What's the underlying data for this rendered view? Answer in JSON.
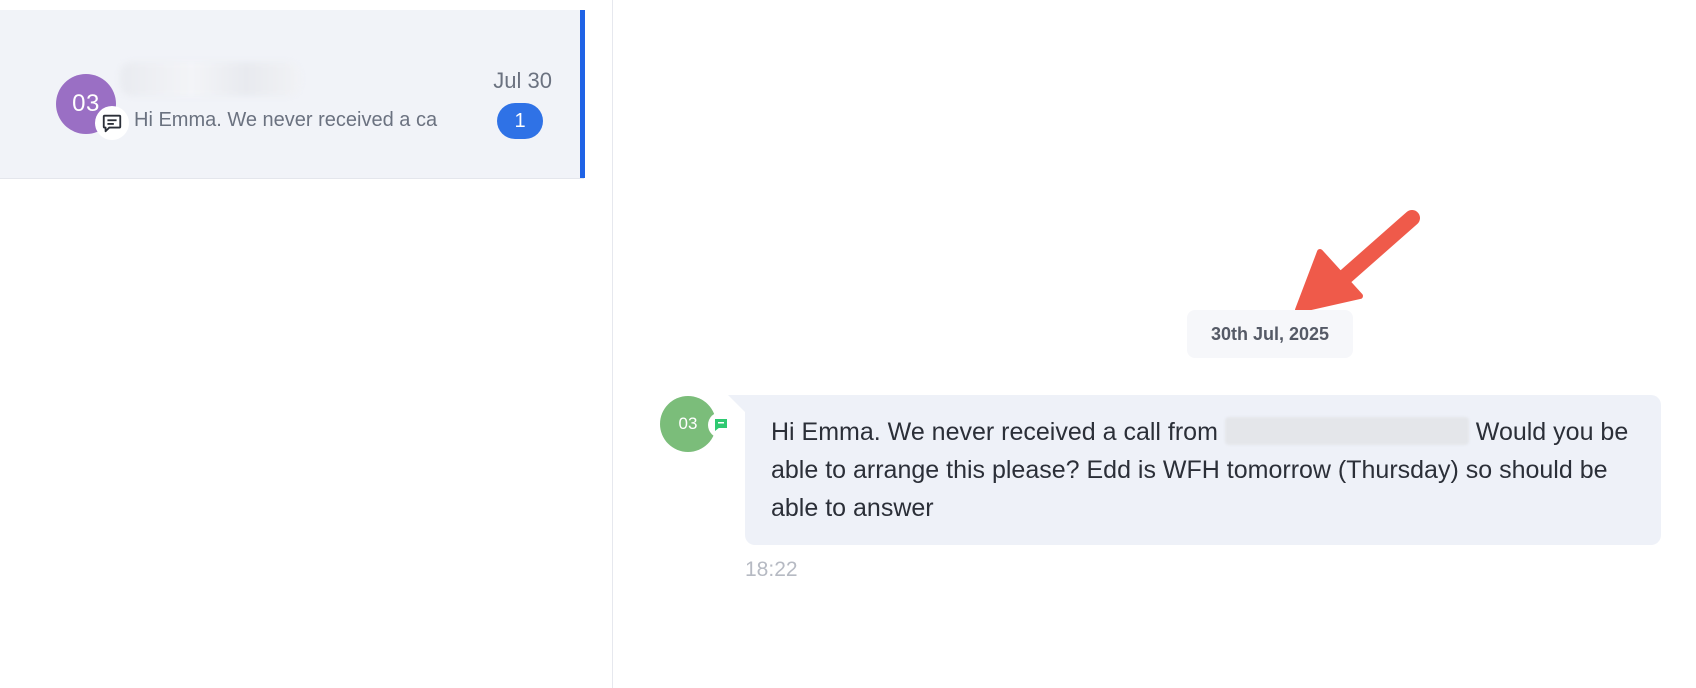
{
  "conversation_list": {
    "items": [
      {
        "avatar_initials": "03",
        "preview": "Hi Emma. We never received a ca",
        "date": "Jul 30",
        "unread_count": "1",
        "channel_icon": "chat-bubble-icon"
      }
    ]
  },
  "thread": {
    "date_separator": "30th Jul, 2025",
    "messages": [
      {
        "avatar_initials": "03",
        "channel_icon": "sms-icon",
        "text_part1": "Hi Emma. We never received a call from ",
        "text_part2": " Would you be able to arrange this please? Edd is WFH tomorrow (Thursday) so should be able to answer",
        "time": "18:22"
      }
    ]
  },
  "colors": {
    "accent_blue": "#1f63e6",
    "unread_badge": "#2f72e6",
    "conversation_avatar": "#9a6fc4",
    "message_avatar": "#7bbd7a",
    "sms_channel": "#2ec971",
    "annotation_arrow": "#ef5a4a"
  }
}
